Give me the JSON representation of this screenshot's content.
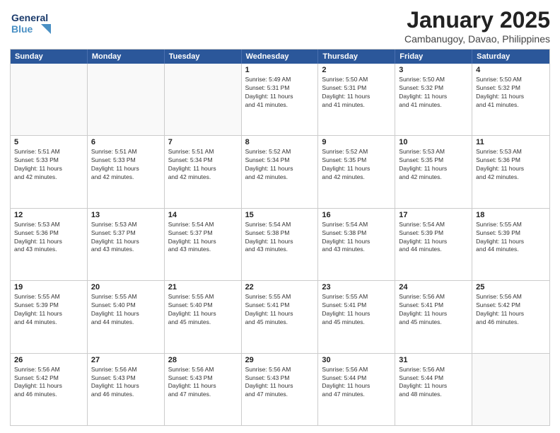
{
  "logo": {
    "line1": "General",
    "line2": "Blue"
  },
  "title": "January 2025",
  "location": "Cambanugoy, Davao, Philippines",
  "days_of_week": [
    "Sunday",
    "Monday",
    "Tuesday",
    "Wednesday",
    "Thursday",
    "Friday",
    "Saturday"
  ],
  "weeks": [
    [
      {
        "day": "",
        "info": ""
      },
      {
        "day": "",
        "info": ""
      },
      {
        "day": "",
        "info": ""
      },
      {
        "day": "1",
        "info": "Sunrise: 5:49 AM\nSunset: 5:31 PM\nDaylight: 11 hours\nand 41 minutes."
      },
      {
        "day": "2",
        "info": "Sunrise: 5:50 AM\nSunset: 5:31 PM\nDaylight: 11 hours\nand 41 minutes."
      },
      {
        "day": "3",
        "info": "Sunrise: 5:50 AM\nSunset: 5:32 PM\nDaylight: 11 hours\nand 41 minutes."
      },
      {
        "day": "4",
        "info": "Sunrise: 5:50 AM\nSunset: 5:32 PM\nDaylight: 11 hours\nand 41 minutes."
      }
    ],
    [
      {
        "day": "5",
        "info": "Sunrise: 5:51 AM\nSunset: 5:33 PM\nDaylight: 11 hours\nand 42 minutes."
      },
      {
        "day": "6",
        "info": "Sunrise: 5:51 AM\nSunset: 5:33 PM\nDaylight: 11 hours\nand 42 minutes."
      },
      {
        "day": "7",
        "info": "Sunrise: 5:51 AM\nSunset: 5:34 PM\nDaylight: 11 hours\nand 42 minutes."
      },
      {
        "day": "8",
        "info": "Sunrise: 5:52 AM\nSunset: 5:34 PM\nDaylight: 11 hours\nand 42 minutes."
      },
      {
        "day": "9",
        "info": "Sunrise: 5:52 AM\nSunset: 5:35 PM\nDaylight: 11 hours\nand 42 minutes."
      },
      {
        "day": "10",
        "info": "Sunrise: 5:53 AM\nSunset: 5:35 PM\nDaylight: 11 hours\nand 42 minutes."
      },
      {
        "day": "11",
        "info": "Sunrise: 5:53 AM\nSunset: 5:36 PM\nDaylight: 11 hours\nand 42 minutes."
      }
    ],
    [
      {
        "day": "12",
        "info": "Sunrise: 5:53 AM\nSunset: 5:36 PM\nDaylight: 11 hours\nand 43 minutes."
      },
      {
        "day": "13",
        "info": "Sunrise: 5:53 AM\nSunset: 5:37 PM\nDaylight: 11 hours\nand 43 minutes."
      },
      {
        "day": "14",
        "info": "Sunrise: 5:54 AM\nSunset: 5:37 PM\nDaylight: 11 hours\nand 43 minutes."
      },
      {
        "day": "15",
        "info": "Sunrise: 5:54 AM\nSunset: 5:38 PM\nDaylight: 11 hours\nand 43 minutes."
      },
      {
        "day": "16",
        "info": "Sunrise: 5:54 AM\nSunset: 5:38 PM\nDaylight: 11 hours\nand 43 minutes."
      },
      {
        "day": "17",
        "info": "Sunrise: 5:54 AM\nSunset: 5:39 PM\nDaylight: 11 hours\nand 44 minutes."
      },
      {
        "day": "18",
        "info": "Sunrise: 5:55 AM\nSunset: 5:39 PM\nDaylight: 11 hours\nand 44 minutes."
      }
    ],
    [
      {
        "day": "19",
        "info": "Sunrise: 5:55 AM\nSunset: 5:39 PM\nDaylight: 11 hours\nand 44 minutes."
      },
      {
        "day": "20",
        "info": "Sunrise: 5:55 AM\nSunset: 5:40 PM\nDaylight: 11 hours\nand 44 minutes."
      },
      {
        "day": "21",
        "info": "Sunrise: 5:55 AM\nSunset: 5:40 PM\nDaylight: 11 hours\nand 45 minutes."
      },
      {
        "day": "22",
        "info": "Sunrise: 5:55 AM\nSunset: 5:41 PM\nDaylight: 11 hours\nand 45 minutes."
      },
      {
        "day": "23",
        "info": "Sunrise: 5:55 AM\nSunset: 5:41 PM\nDaylight: 11 hours\nand 45 minutes."
      },
      {
        "day": "24",
        "info": "Sunrise: 5:56 AM\nSunset: 5:41 PM\nDaylight: 11 hours\nand 45 minutes."
      },
      {
        "day": "25",
        "info": "Sunrise: 5:56 AM\nSunset: 5:42 PM\nDaylight: 11 hours\nand 46 minutes."
      }
    ],
    [
      {
        "day": "26",
        "info": "Sunrise: 5:56 AM\nSunset: 5:42 PM\nDaylight: 11 hours\nand 46 minutes."
      },
      {
        "day": "27",
        "info": "Sunrise: 5:56 AM\nSunset: 5:43 PM\nDaylight: 11 hours\nand 46 minutes."
      },
      {
        "day": "28",
        "info": "Sunrise: 5:56 AM\nSunset: 5:43 PM\nDaylight: 11 hours\nand 47 minutes."
      },
      {
        "day": "29",
        "info": "Sunrise: 5:56 AM\nSunset: 5:43 PM\nDaylight: 11 hours\nand 47 minutes."
      },
      {
        "day": "30",
        "info": "Sunrise: 5:56 AM\nSunset: 5:44 PM\nDaylight: 11 hours\nand 47 minutes."
      },
      {
        "day": "31",
        "info": "Sunrise: 5:56 AM\nSunset: 5:44 PM\nDaylight: 11 hours\nand 48 minutes."
      },
      {
        "day": "",
        "info": ""
      }
    ]
  ]
}
